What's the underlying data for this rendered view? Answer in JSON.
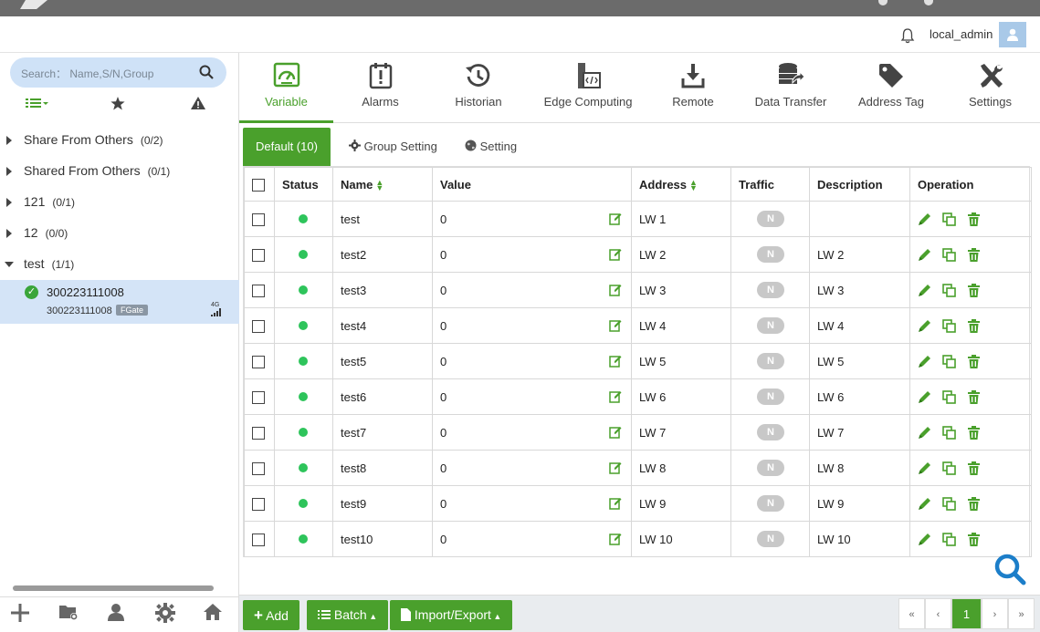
{
  "user": {
    "name": "local_admin"
  },
  "sidebar": {
    "search_placeholder": "Search： Name,S/N,Group",
    "tree": [
      {
        "label": "Share From Others",
        "count": "(0/2)"
      },
      {
        "label": "Shared From Others",
        "count": "(0/1)"
      },
      {
        "label": "121",
        "count": "(0/1)"
      },
      {
        "label": "12",
        "count": "(0/0)"
      },
      {
        "label": "test",
        "count": "(1/1)"
      }
    ],
    "device": {
      "name": "300223111008",
      "sn": "300223111008",
      "badge": "FGate",
      "signal": "4G"
    }
  },
  "nav": [
    {
      "label": "Variable"
    },
    {
      "label": "Alarms"
    },
    {
      "label": "Historian"
    },
    {
      "label": "Edge Computing"
    },
    {
      "label": "Remote"
    },
    {
      "label": "Data Transfer"
    },
    {
      "label": "Address Tag"
    },
    {
      "label": "Settings"
    }
  ],
  "subtabs": {
    "default": "Default (10)",
    "group": "Group Setting",
    "setting": "Setting"
  },
  "table": {
    "headers": {
      "status": "Status",
      "name": "Name",
      "value": "Value",
      "address": "Address",
      "traffic": "Traffic",
      "description": "Description",
      "operation": "Operation"
    },
    "traffic_label": "N",
    "rows": [
      {
        "name": "test",
        "value": "0",
        "address": "LW 1",
        "description": ""
      },
      {
        "name": "test2",
        "value": "0",
        "address": "LW 2",
        "description": "LW 2"
      },
      {
        "name": "test3",
        "value": "0",
        "address": "LW 3",
        "description": "LW 3"
      },
      {
        "name": "test4",
        "value": "0",
        "address": "LW 4",
        "description": "LW 4"
      },
      {
        "name": "test5",
        "value": "0",
        "address": "LW 5",
        "description": "LW 5"
      },
      {
        "name": "test6",
        "value": "0",
        "address": "LW 6",
        "description": "LW 6"
      },
      {
        "name": "test7",
        "value": "0",
        "address": "LW 7",
        "description": "LW 7"
      },
      {
        "name": "test8",
        "value": "0",
        "address": "LW 8",
        "description": "LW 8"
      },
      {
        "name": "test9",
        "value": "0",
        "address": "LW 9",
        "description": "LW 9"
      },
      {
        "name": "test10",
        "value": "0",
        "address": "LW 10",
        "description": "LW 10"
      }
    ]
  },
  "footer": {
    "add_label": "Add",
    "batch_label": "Batch",
    "import_label": "Import/Export",
    "pager": {
      "first": "«",
      "prev": "‹",
      "current": "1",
      "next": "›",
      "last": "»"
    }
  },
  "colors": {
    "accent": "#4aa02c",
    "status_ok": "#2ec45b",
    "selected_row": "#d4e4f7"
  }
}
